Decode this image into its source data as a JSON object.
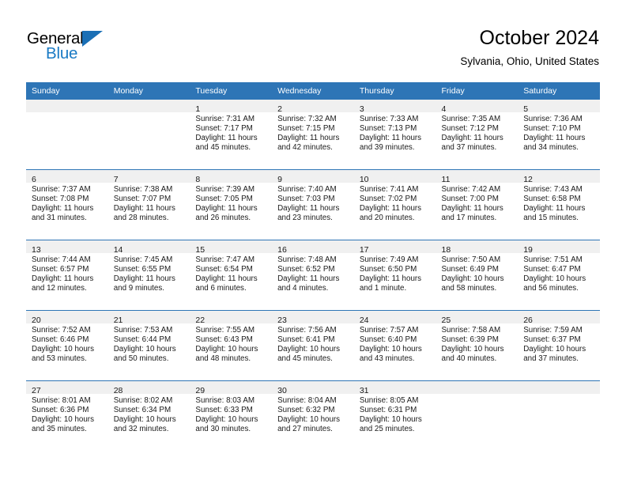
{
  "brand": {
    "logo_text_top": "General",
    "logo_text_bottom": "Blue",
    "logo_icon": "blue-triangle-icon",
    "accent_color": "#2e75b6",
    "logo_blue": "#1a7ac4"
  },
  "header": {
    "month_title": "October 2024",
    "location": "Sylvania, Ohio, United States"
  },
  "calendar": {
    "weekday_headers": [
      "Sunday",
      "Monday",
      "Tuesday",
      "Wednesday",
      "Thursday",
      "Friday",
      "Saturday"
    ],
    "weeks": [
      [
        {
          "day": "",
          "lines": []
        },
        {
          "day": "",
          "lines": []
        },
        {
          "day": "1",
          "lines": [
            "Sunrise: 7:31 AM",
            "Sunset: 7:17 PM",
            "Daylight: 11 hours",
            "and 45 minutes."
          ]
        },
        {
          "day": "2",
          "lines": [
            "Sunrise: 7:32 AM",
            "Sunset: 7:15 PM",
            "Daylight: 11 hours",
            "and 42 minutes."
          ]
        },
        {
          "day": "3",
          "lines": [
            "Sunrise: 7:33 AM",
            "Sunset: 7:13 PM",
            "Daylight: 11 hours",
            "and 39 minutes."
          ]
        },
        {
          "day": "4",
          "lines": [
            "Sunrise: 7:35 AM",
            "Sunset: 7:12 PM",
            "Daylight: 11 hours",
            "and 37 minutes."
          ]
        },
        {
          "day": "5",
          "lines": [
            "Sunrise: 7:36 AM",
            "Sunset: 7:10 PM",
            "Daylight: 11 hours",
            "and 34 minutes."
          ]
        }
      ],
      [
        {
          "day": "6",
          "lines": [
            "Sunrise: 7:37 AM",
            "Sunset: 7:08 PM",
            "Daylight: 11 hours",
            "and 31 minutes."
          ]
        },
        {
          "day": "7",
          "lines": [
            "Sunrise: 7:38 AM",
            "Sunset: 7:07 PM",
            "Daylight: 11 hours",
            "and 28 minutes."
          ]
        },
        {
          "day": "8",
          "lines": [
            "Sunrise: 7:39 AM",
            "Sunset: 7:05 PM",
            "Daylight: 11 hours",
            "and 26 minutes."
          ]
        },
        {
          "day": "9",
          "lines": [
            "Sunrise: 7:40 AM",
            "Sunset: 7:03 PM",
            "Daylight: 11 hours",
            "and 23 minutes."
          ]
        },
        {
          "day": "10",
          "lines": [
            "Sunrise: 7:41 AM",
            "Sunset: 7:02 PM",
            "Daylight: 11 hours",
            "and 20 minutes."
          ]
        },
        {
          "day": "11",
          "lines": [
            "Sunrise: 7:42 AM",
            "Sunset: 7:00 PM",
            "Daylight: 11 hours",
            "and 17 minutes."
          ]
        },
        {
          "day": "12",
          "lines": [
            "Sunrise: 7:43 AM",
            "Sunset: 6:58 PM",
            "Daylight: 11 hours",
            "and 15 minutes."
          ]
        }
      ],
      [
        {
          "day": "13",
          "lines": [
            "Sunrise: 7:44 AM",
            "Sunset: 6:57 PM",
            "Daylight: 11 hours",
            "and 12 minutes."
          ]
        },
        {
          "day": "14",
          "lines": [
            "Sunrise: 7:45 AM",
            "Sunset: 6:55 PM",
            "Daylight: 11 hours",
            "and 9 minutes."
          ]
        },
        {
          "day": "15",
          "lines": [
            "Sunrise: 7:47 AM",
            "Sunset: 6:54 PM",
            "Daylight: 11 hours",
            "and 6 minutes."
          ]
        },
        {
          "day": "16",
          "lines": [
            "Sunrise: 7:48 AM",
            "Sunset: 6:52 PM",
            "Daylight: 11 hours",
            "and 4 minutes."
          ]
        },
        {
          "day": "17",
          "lines": [
            "Sunrise: 7:49 AM",
            "Sunset: 6:50 PM",
            "Daylight: 11 hours",
            "and 1 minute."
          ]
        },
        {
          "day": "18",
          "lines": [
            "Sunrise: 7:50 AM",
            "Sunset: 6:49 PM",
            "Daylight: 10 hours",
            "and 58 minutes."
          ]
        },
        {
          "day": "19",
          "lines": [
            "Sunrise: 7:51 AM",
            "Sunset: 6:47 PM",
            "Daylight: 10 hours",
            "and 56 minutes."
          ]
        }
      ],
      [
        {
          "day": "20",
          "lines": [
            "Sunrise: 7:52 AM",
            "Sunset: 6:46 PM",
            "Daylight: 10 hours",
            "and 53 minutes."
          ]
        },
        {
          "day": "21",
          "lines": [
            "Sunrise: 7:53 AM",
            "Sunset: 6:44 PM",
            "Daylight: 10 hours",
            "and 50 minutes."
          ]
        },
        {
          "day": "22",
          "lines": [
            "Sunrise: 7:55 AM",
            "Sunset: 6:43 PM",
            "Daylight: 10 hours",
            "and 48 minutes."
          ]
        },
        {
          "day": "23",
          "lines": [
            "Sunrise: 7:56 AM",
            "Sunset: 6:41 PM",
            "Daylight: 10 hours",
            "and 45 minutes."
          ]
        },
        {
          "day": "24",
          "lines": [
            "Sunrise: 7:57 AM",
            "Sunset: 6:40 PM",
            "Daylight: 10 hours",
            "and 43 minutes."
          ]
        },
        {
          "day": "25",
          "lines": [
            "Sunrise: 7:58 AM",
            "Sunset: 6:39 PM",
            "Daylight: 10 hours",
            "and 40 minutes."
          ]
        },
        {
          "day": "26",
          "lines": [
            "Sunrise: 7:59 AM",
            "Sunset: 6:37 PM",
            "Daylight: 10 hours",
            "and 37 minutes."
          ]
        }
      ],
      [
        {
          "day": "27",
          "lines": [
            "Sunrise: 8:01 AM",
            "Sunset: 6:36 PM",
            "Daylight: 10 hours",
            "and 35 minutes."
          ]
        },
        {
          "day": "28",
          "lines": [
            "Sunrise: 8:02 AM",
            "Sunset: 6:34 PM",
            "Daylight: 10 hours",
            "and 32 minutes."
          ]
        },
        {
          "day": "29",
          "lines": [
            "Sunrise: 8:03 AM",
            "Sunset: 6:33 PM",
            "Daylight: 10 hours",
            "and 30 minutes."
          ]
        },
        {
          "day": "30",
          "lines": [
            "Sunrise: 8:04 AM",
            "Sunset: 6:32 PM",
            "Daylight: 10 hours",
            "and 27 minutes."
          ]
        },
        {
          "day": "31",
          "lines": [
            "Sunrise: 8:05 AM",
            "Sunset: 6:31 PM",
            "Daylight: 10 hours",
            "and 25 minutes."
          ]
        },
        {
          "day": "",
          "lines": []
        },
        {
          "day": "",
          "lines": []
        }
      ]
    ]
  }
}
